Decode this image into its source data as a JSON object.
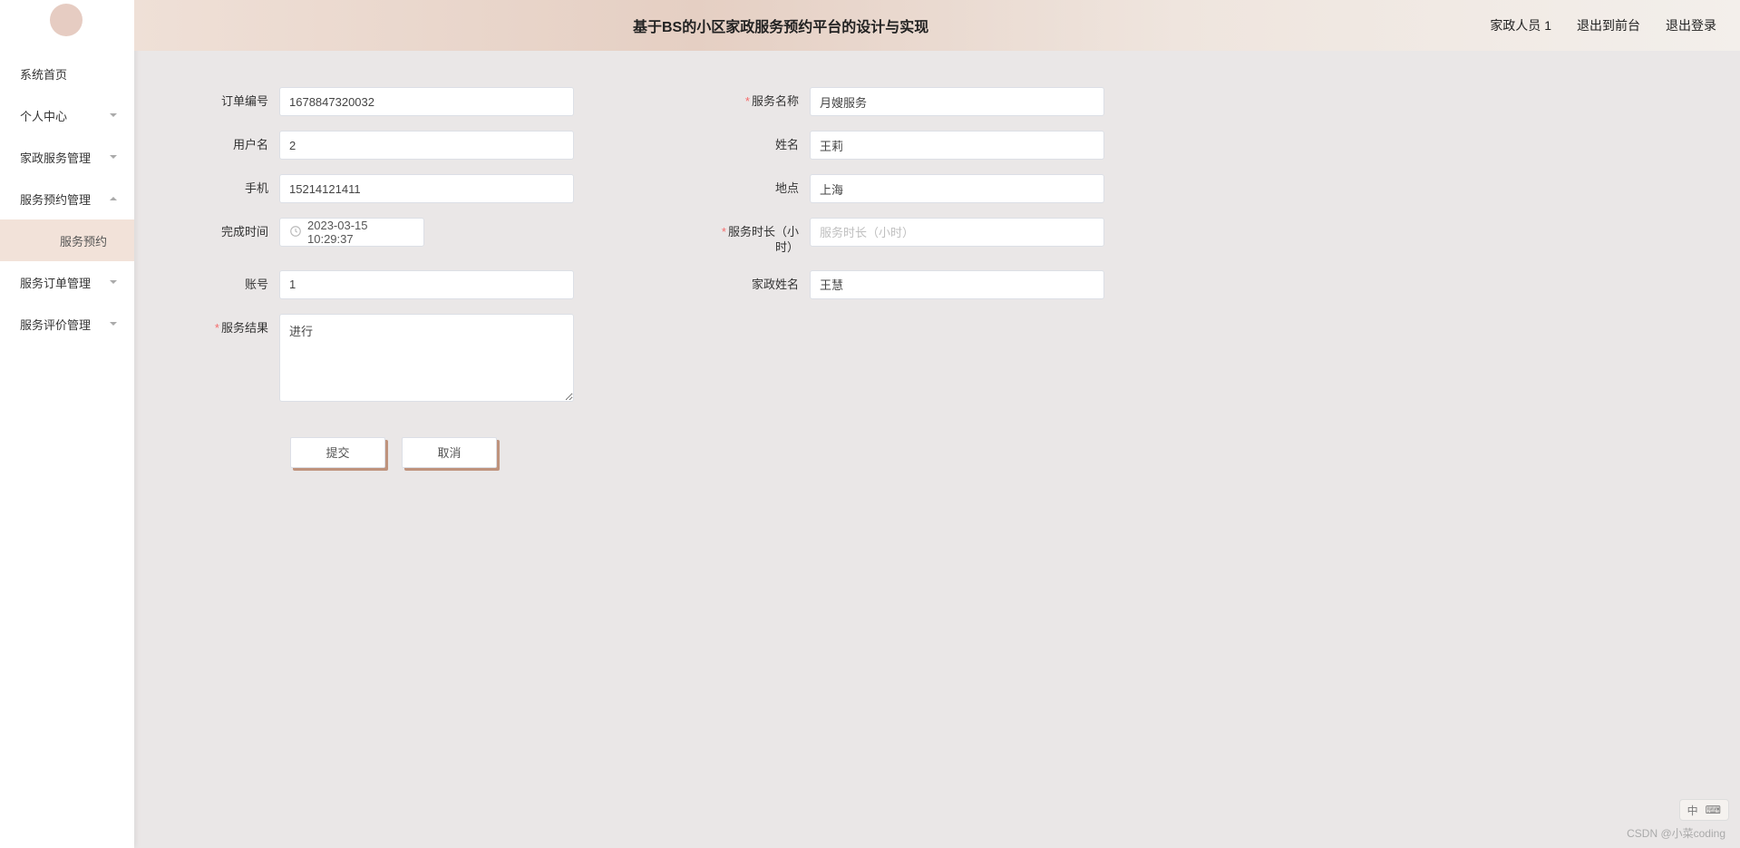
{
  "header": {
    "title": "基于BS的小区家政服务预约平台的设计与实现",
    "user": "家政人员 1",
    "exitFront": "退出到前台",
    "logout": "退出登录"
  },
  "sidebar": {
    "items": [
      {
        "label": "系统首页",
        "expandable": false
      },
      {
        "label": "个人中心",
        "expandable": true,
        "expanded": false
      },
      {
        "label": "家政服务管理",
        "expandable": true,
        "expanded": false
      },
      {
        "label": "服务预约管理",
        "expandable": true,
        "expanded": true,
        "children": [
          {
            "label": "服务预约"
          }
        ]
      },
      {
        "label": "服务订单管理",
        "expandable": true,
        "expanded": false
      },
      {
        "label": "服务评价管理",
        "expandable": true,
        "expanded": false
      }
    ]
  },
  "form": {
    "orderNo": {
      "label": "订单编号",
      "value": "1678847320032"
    },
    "serviceName": {
      "label": "服务名称",
      "value": "月嫂服务",
      "required": true
    },
    "username": {
      "label": "用户名",
      "value": "2"
    },
    "fullName": {
      "label": "姓名",
      "value": "王莉"
    },
    "phone": {
      "label": "手机",
      "value": "15214121411"
    },
    "location": {
      "label": "地点",
      "value": "上海"
    },
    "finishTime": {
      "label": "完成时间",
      "value": "2023-03-15 10:29:37"
    },
    "duration": {
      "label": "服务时长（小时）",
      "value": "",
      "placeholder": "服务时长（小时）",
      "required": true
    },
    "account": {
      "label": "账号",
      "value": "1"
    },
    "staffName": {
      "label": "家政姓名",
      "value": "王慧"
    },
    "result": {
      "label": "服务结果",
      "value": "进行",
      "required": true
    }
  },
  "buttons": {
    "submit": "提交",
    "cancel": "取消"
  },
  "footer": {
    "watermark": "CSDN @小菜coding",
    "ime": "中"
  }
}
